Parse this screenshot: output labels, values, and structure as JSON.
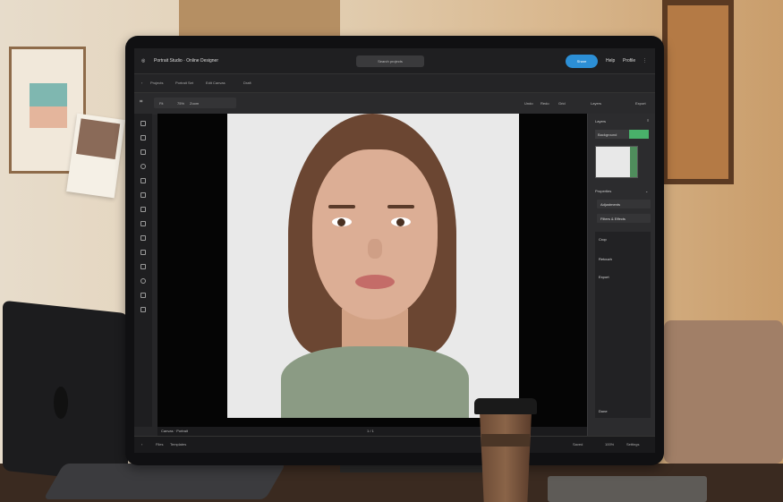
{
  "window": {
    "title": "Portrait Studio · Online Designer",
    "search_label": "Search projects",
    "share_label": "Share",
    "top_right": [
      "Help",
      "Profile"
    ]
  },
  "breadcrumb": [
    "Projects",
    "Portrait Set",
    "Edit Canvas",
    "Draft"
  ],
  "toolbar": {
    "items": [
      "Fit",
      "75%",
      "Zoom"
    ],
    "right_items": [
      "Undo",
      "Redo",
      "Grid",
      "Layers",
      "Export"
    ]
  },
  "panel": {
    "title": "Layers",
    "toggle_label": "Background",
    "section_title": "Properties",
    "rows": [
      "Adjustments",
      "Filters & Effects"
    ],
    "list_items": [
      "Crop",
      "Retouch",
      "Export"
    ],
    "footer": "Done"
  },
  "bottom": {
    "status": "Canvas · Portrait",
    "page_indicator": "1 / 1"
  },
  "dock": {
    "left": [
      "Files",
      "Templates"
    ],
    "right": [
      "Saved",
      "100%",
      "Settings"
    ]
  },
  "colors": {
    "accent": "#2c8fd6",
    "toggle_on": "#49b06a",
    "editor_bg": "#262628"
  }
}
